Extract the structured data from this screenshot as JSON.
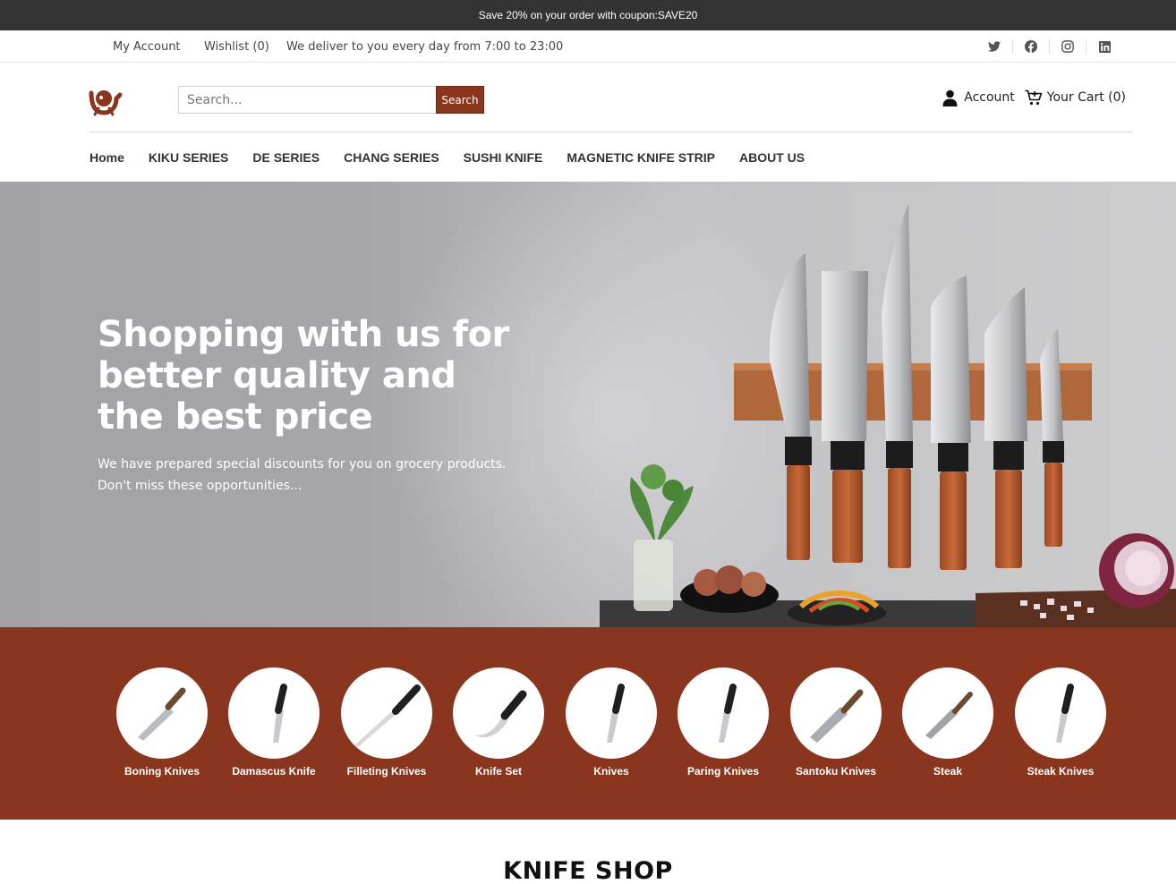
{
  "announcement": "Save 20% on your order with coupon:SAVE20",
  "topbar": {
    "my_account": "My Account",
    "wishlist": "Wishlist (0)",
    "delivery": "We deliver to you every day from 7:00 to 23:00",
    "socials": [
      "twitter-icon",
      "facebook-icon",
      "instagram-icon",
      "linkedin-icon"
    ]
  },
  "header": {
    "search_placeholder": "Search...",
    "search_button": "Search",
    "account": "Account",
    "cart": "Your Cart (0)"
  },
  "nav": [
    "Home",
    "KIKU SERIES",
    "DE SERIES",
    "CHANG SERIES",
    "SUSHI KNIFE",
    "MAGNETIC KNIFE STRIP",
    "ABOUT US"
  ],
  "hero": {
    "title": "Shopping with us for better quality and the best price",
    "subtitle_line1": "We have prepared special discounts for you on grocery products.",
    "subtitle_line2": "Don't miss these opportunities..."
  },
  "categories": [
    "Boning Knives",
    "Damascus Knife",
    "Filleting Knives",
    "Knife Set",
    "Knives",
    "Paring Knives",
    "Santoku Knives",
    "Steak",
    "Steak Knives"
  ],
  "section_title": "KNIFE SHOP",
  "colors": {
    "brand": "#8a351d",
    "announce_bg": "#333333"
  }
}
